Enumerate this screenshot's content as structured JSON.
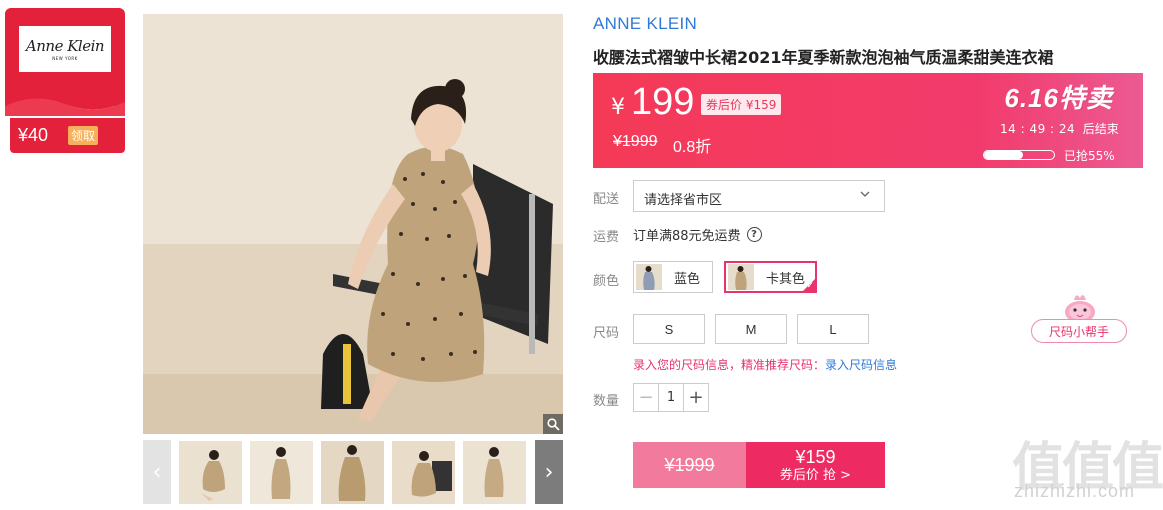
{
  "coupon": {
    "logo_text": "Anne Klein",
    "logo_sub": "NEW YORK",
    "amount": "¥40",
    "claim_label": "领取"
  },
  "product": {
    "brand": "ANNE KLEIN",
    "title": "收腰法式褶皱中长裙2021年夏季新款泡泡袖气质温柔甜美连衣裙"
  },
  "price": {
    "currency": "¥",
    "current": "199",
    "after_coupon": "券后价 ¥159",
    "original": "¥1999",
    "discount": "0.8折",
    "promo_num": "6.16",
    "promo_text": "特卖",
    "countdown": "14 : 49 : 24",
    "countdown_suffix": "后结束",
    "sold_fraction": 0.55,
    "sold_label": "已抢55%"
  },
  "delivery": {
    "label": "配送",
    "placeholder": "请选择省市区"
  },
  "shipping": {
    "label": "运费",
    "text": "订单满88元免运费"
  },
  "colors": {
    "label": "颜色",
    "options": [
      {
        "name": "蓝色"
      },
      {
        "name": "卡其色"
      }
    ]
  },
  "sizes": {
    "label": "尺码",
    "options": [
      "S",
      "M",
      "L"
    ],
    "hint": "录入您的尺码信息，精准推荐尺码：",
    "hint_link": "录入尺码信息"
  },
  "quantity": {
    "label": "数量",
    "value": "1",
    "minus": "−",
    "plus": "+"
  },
  "buy": {
    "original": "¥1999",
    "price": "¥159",
    "label": "券后价 抢 >"
  },
  "helper": {
    "label": "尺码小帮手"
  },
  "watermark": {
    "logo": "值值值",
    "site": "zhizhizhi.com"
  },
  "colors_theme": {
    "accent": "#ee2a62",
    "brand_blue": "#2f7ad8",
    "coupon_red": "#e3213a"
  }
}
